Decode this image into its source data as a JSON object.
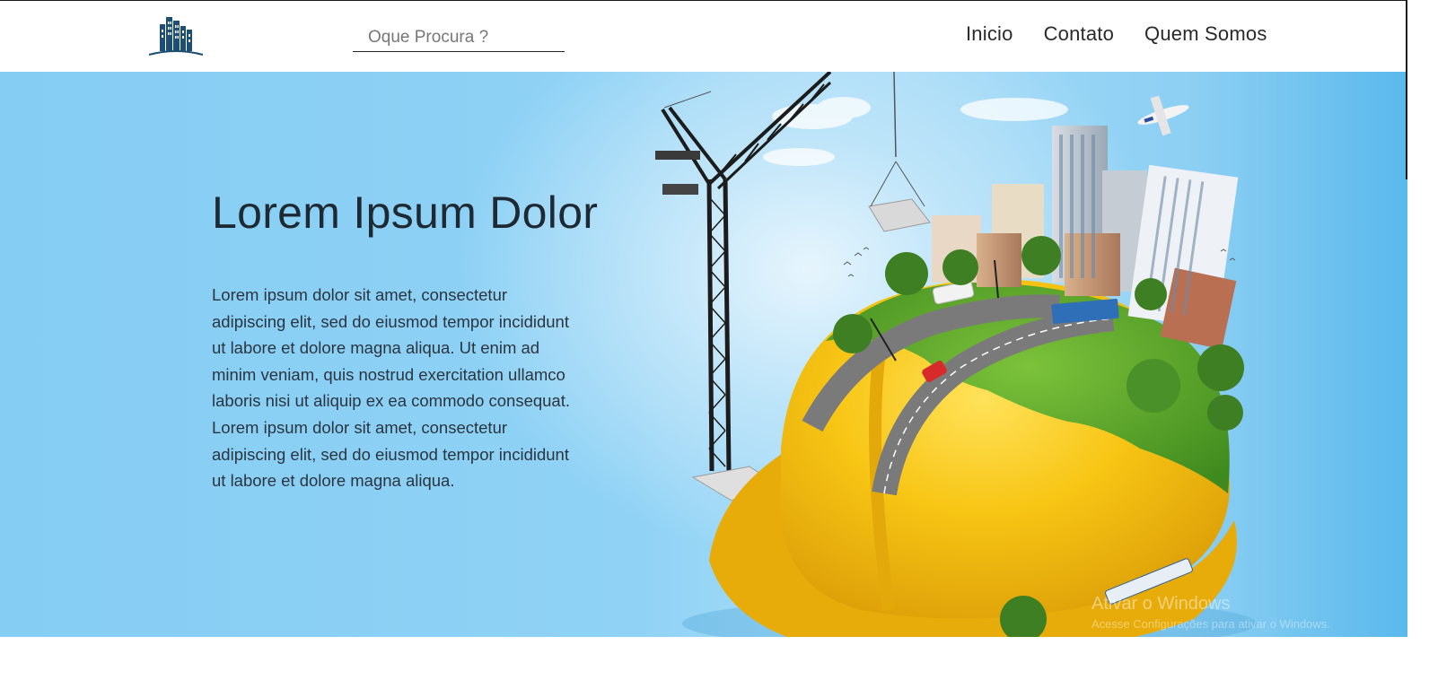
{
  "header": {
    "logo_icon": "buildings-logo-icon",
    "search": {
      "placeholder": "Oque Procura ?",
      "value": ""
    },
    "nav": [
      {
        "label": "Inicio"
      },
      {
        "label": "Contato"
      },
      {
        "label": "Quem Somos"
      }
    ]
  },
  "hero": {
    "title": "Lorem Ipsum Dolor",
    "text": "Lorem ipsum dolor sit amet, consectetur adipiscing elit, sed do eiusmod tempor incididunt ut labore et dolore magna aliqua. Ut enim ad minim veniam, quis nostrud exercitation ullamco laboris nisi ut aliquip ex ea commodo consequat. Lorem ipsum dolor sit amet, consectetur adipiscing elit, sed do eiusmod tempor incididunt ut labore et dolore magna aliqua.",
    "illustration": "construction-helmet-city-globe"
  },
  "watermark": {
    "title": "Ativar o Windows",
    "subtitle": "Acesse Configurações para ativar o Windows."
  },
  "colors": {
    "hero_sky": "#8fd2f5",
    "helmet_yellow": "#f6c514",
    "logo_navy": "#1d4f73",
    "text_dark": "#1e2a33"
  }
}
